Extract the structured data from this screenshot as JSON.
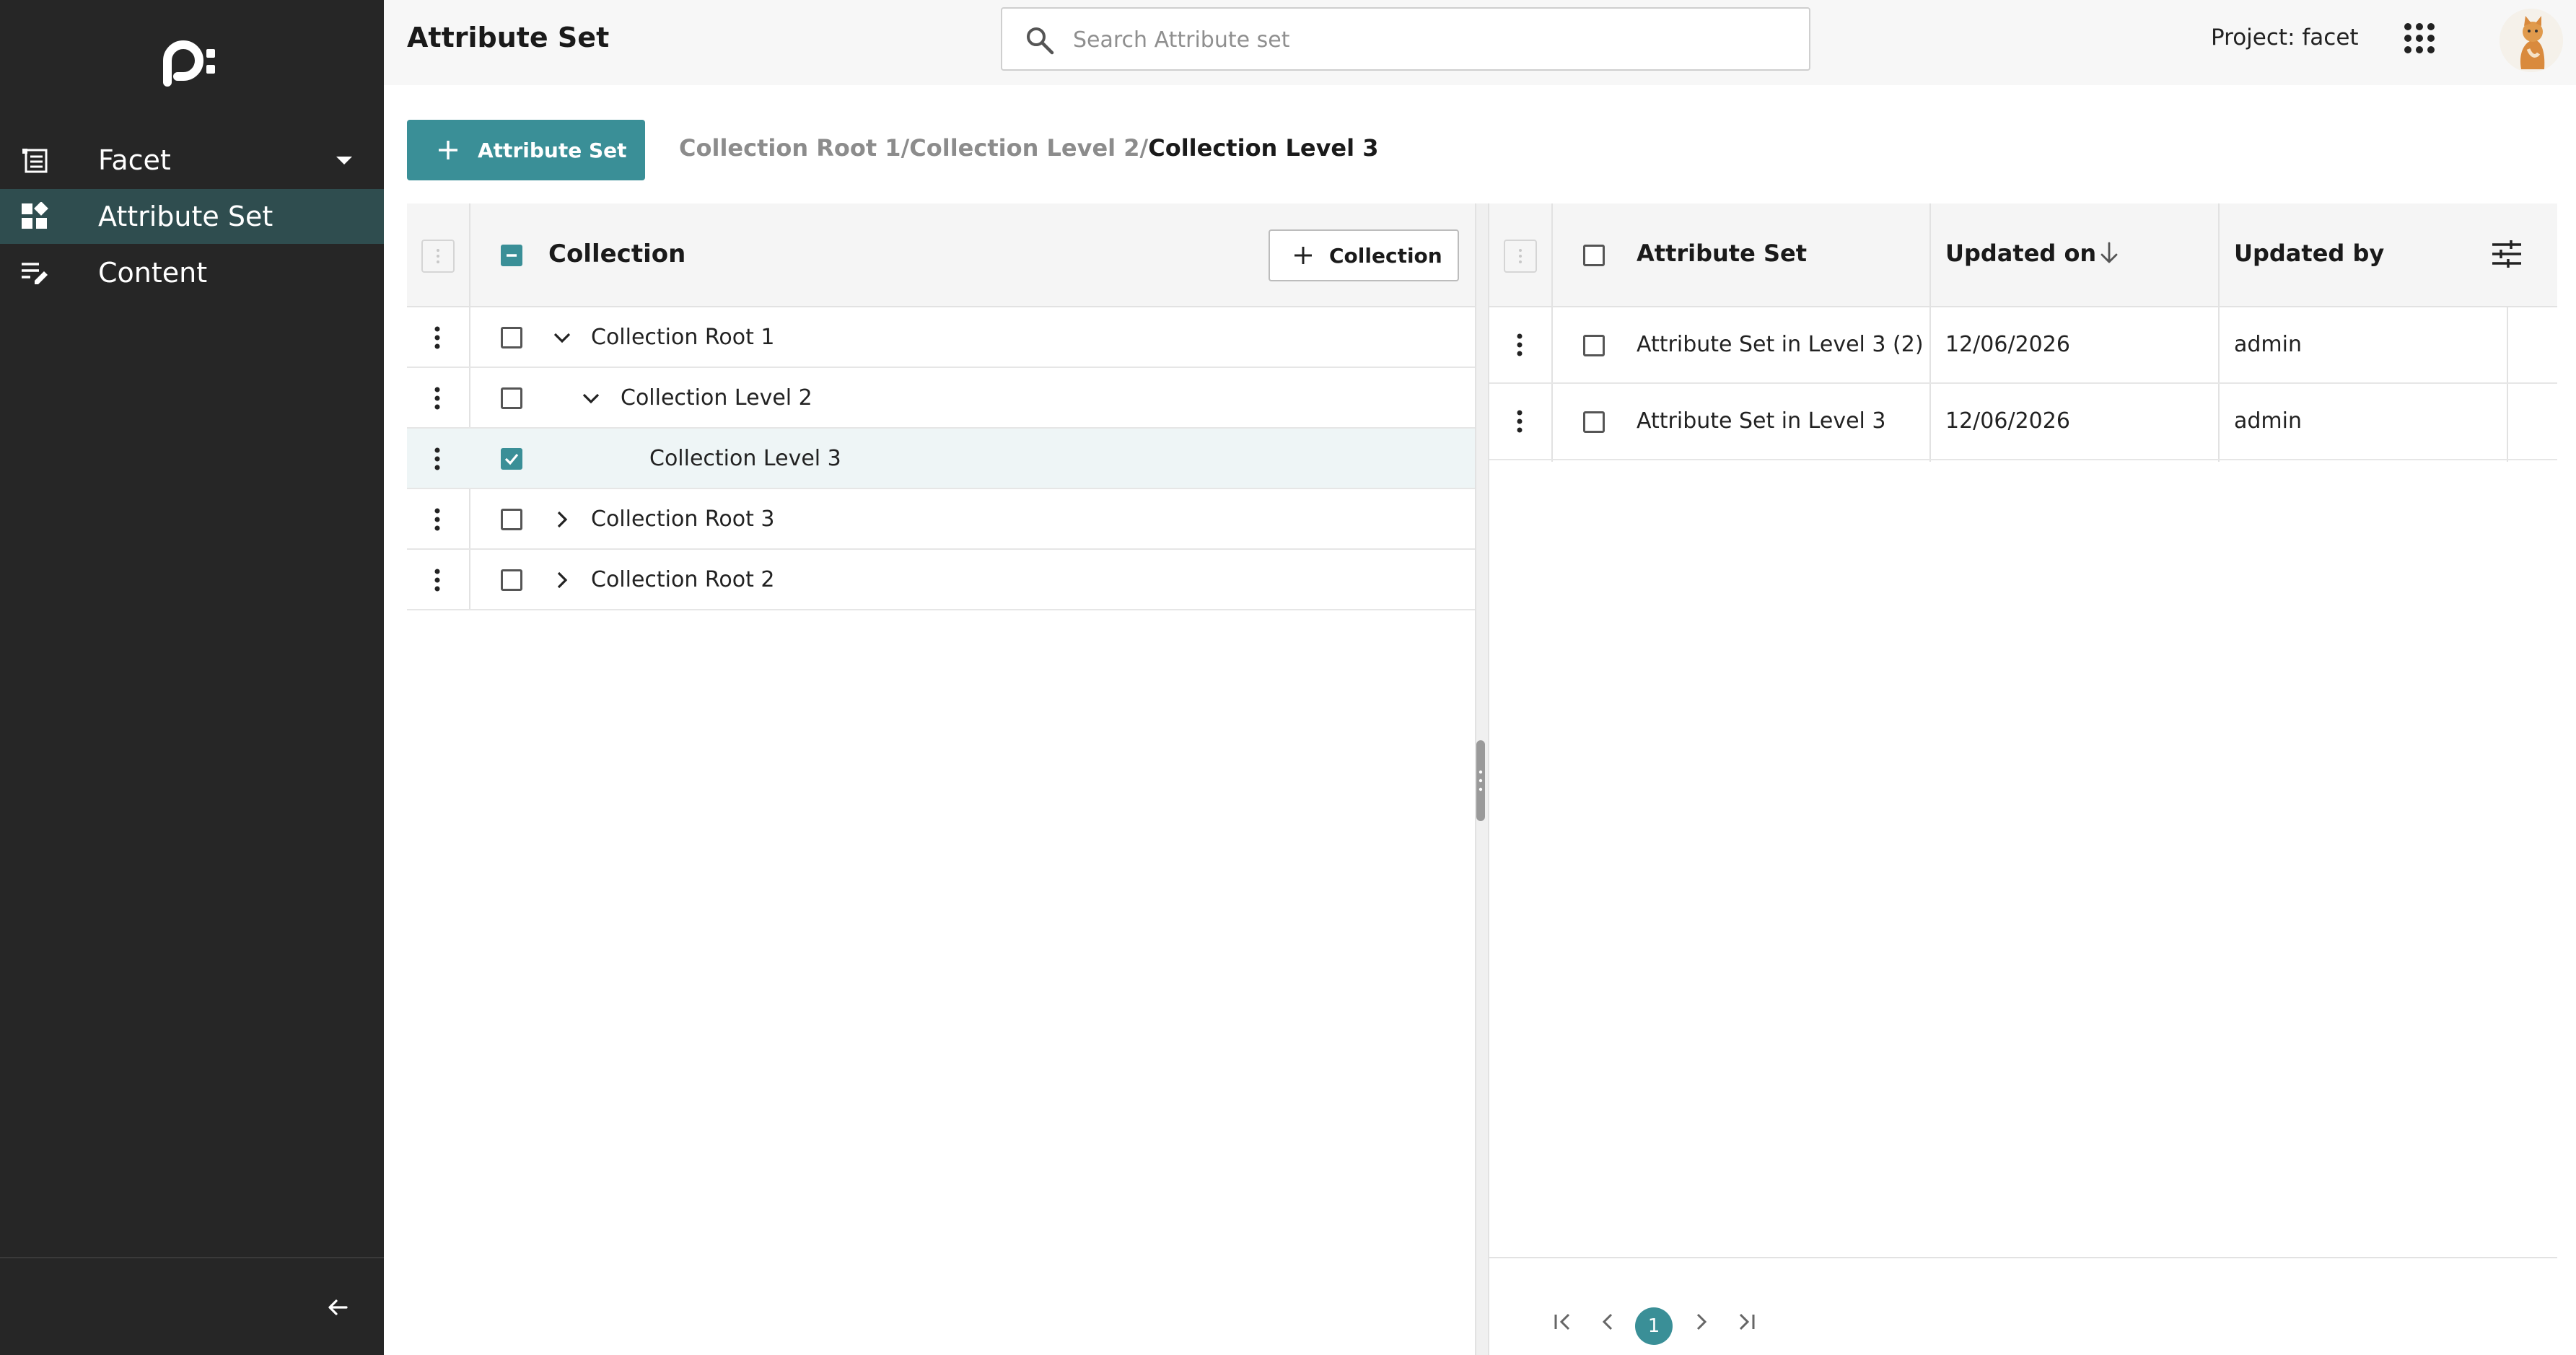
{
  "app": {
    "page_title": "Attribute Set",
    "project_label": "Project: facet"
  },
  "search": {
    "placeholder": "Search Attribute set",
    "value": ""
  },
  "sidebar": {
    "items": [
      {
        "label": "Facet",
        "icon": "list-icon",
        "expanded": true
      },
      {
        "label": "Attribute Set",
        "icon": "widgets-icon",
        "active": true
      },
      {
        "label": "Content",
        "icon": "edit-list-icon"
      }
    ]
  },
  "toolbar": {
    "add_attribute_set_label": "Attribute Set"
  },
  "breadcrumb": {
    "items": [
      "Collection Root 1",
      "Collection Level 2",
      "Collection Level 3"
    ],
    "separator": "/"
  },
  "collections": {
    "header_title": "Collection",
    "add_collection_label": "Collection",
    "rows": [
      {
        "label": "Collection Root 1",
        "level": 0,
        "toggle": "expanded",
        "checked": false
      },
      {
        "label": "Collection Level 2",
        "level": 1,
        "toggle": "expanded",
        "checked": false
      },
      {
        "label": "Collection Level 3",
        "level": 2,
        "toggle": "none",
        "checked": true
      },
      {
        "label": "Collection Root 3",
        "level": 0,
        "toggle": "collapsed",
        "checked": false
      },
      {
        "label": "Collection Root 2",
        "level": 0,
        "toggle": "collapsed",
        "checked": false
      }
    ]
  },
  "attribute_sets": {
    "columns": [
      "Attribute Set",
      "Updated on",
      "Updated by"
    ],
    "sort_column": "Updated on",
    "sort_direction": "descending",
    "rows": [
      {
        "name": "Attribute Set in Level 3 (2)",
        "updated_on": "12/06/2026",
        "updated_by": "admin"
      },
      {
        "name": "Attribute Set in Level 3",
        "updated_on": "12/06/2026",
        "updated_by": "admin"
      }
    ]
  },
  "pagination": {
    "current_page": "1"
  },
  "colors": {
    "accent": "#3a8f97",
    "sidebar_bg": "#262626",
    "sidebar_active": "#2f4d4f"
  }
}
